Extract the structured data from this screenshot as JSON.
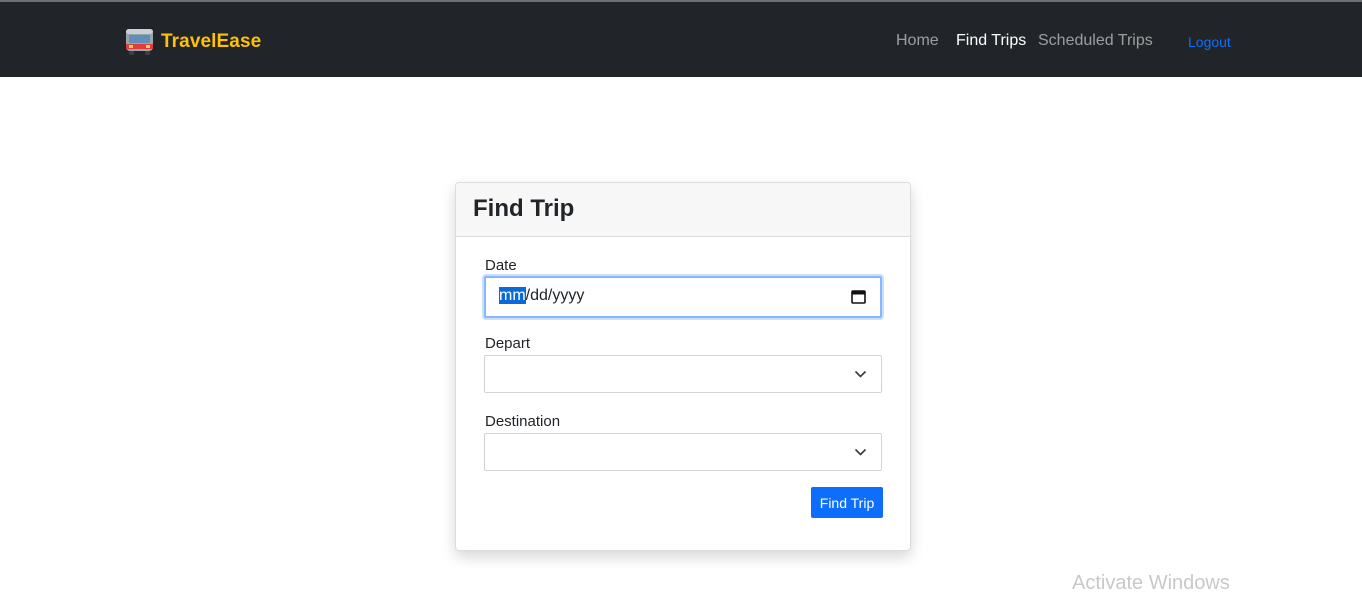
{
  "navbar": {
    "brand_name": "TravelEase",
    "brand_icon": "bus-icon",
    "links": [
      {
        "label": "Home",
        "active": false
      },
      {
        "label": "Find Trips",
        "active": true
      },
      {
        "label": "Scheduled Trips",
        "active": false
      }
    ],
    "logout_label": "Logout"
  },
  "find_trip": {
    "title": "Find Trip",
    "date": {
      "label": "Date",
      "month_placeholder": "mm",
      "rest_placeholder": "/dd/yyyy",
      "icon": "calendar-icon"
    },
    "depart": {
      "label": "Depart",
      "value": ""
    },
    "destination": {
      "label": "Destination",
      "value": ""
    },
    "submit_label": "Find Trip"
  },
  "system": {
    "watermark": "Activate Windows"
  },
  "colors": {
    "navbar_bg": "#212529",
    "brand": "#ffc107",
    "primary": "#0d6efd"
  }
}
